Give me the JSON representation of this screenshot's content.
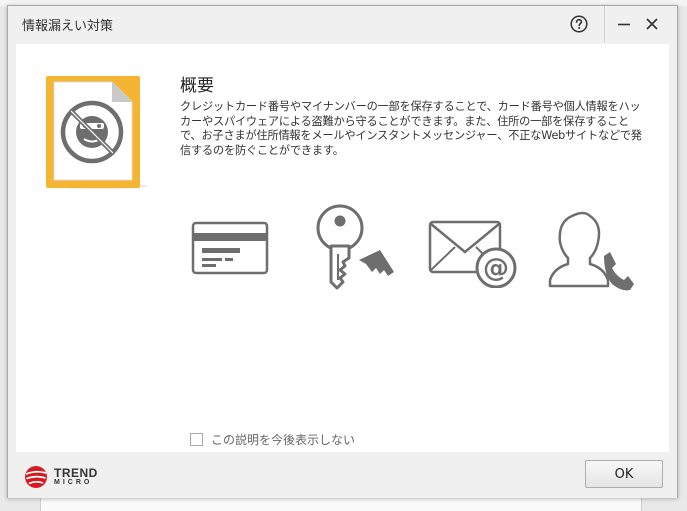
{
  "window": {
    "title": "情報漏えい対策"
  },
  "main": {
    "heading": "概要",
    "description": "クレジットカード番号やマイナンバーの一部を保存することで、カード番号や個人情報をハッカーやスパイウェアによる盗難から守ることができます。また、住所の一部を保存することで、お子さまが住所情報をメールやインスタントメッセンジャー、不正なWebサイトなどで発信するのを防ぐことができます。"
  },
  "features": [
    {
      "icon": "credit-card-icon"
    },
    {
      "icon": "key-icon"
    },
    {
      "icon": "email-icon"
    },
    {
      "icon": "contact-phone-icon"
    }
  ],
  "options": {
    "dont_show_label": "この説明を今後表示しない",
    "dont_show_checked": false
  },
  "footer": {
    "logo_line1": "TREND",
    "logo_line2": "MICRO",
    "ok_label": "OK"
  },
  "colors": {
    "accent": "#f5b533",
    "icon_gray": "#6e6e6e",
    "brand_red": "#d71920"
  }
}
